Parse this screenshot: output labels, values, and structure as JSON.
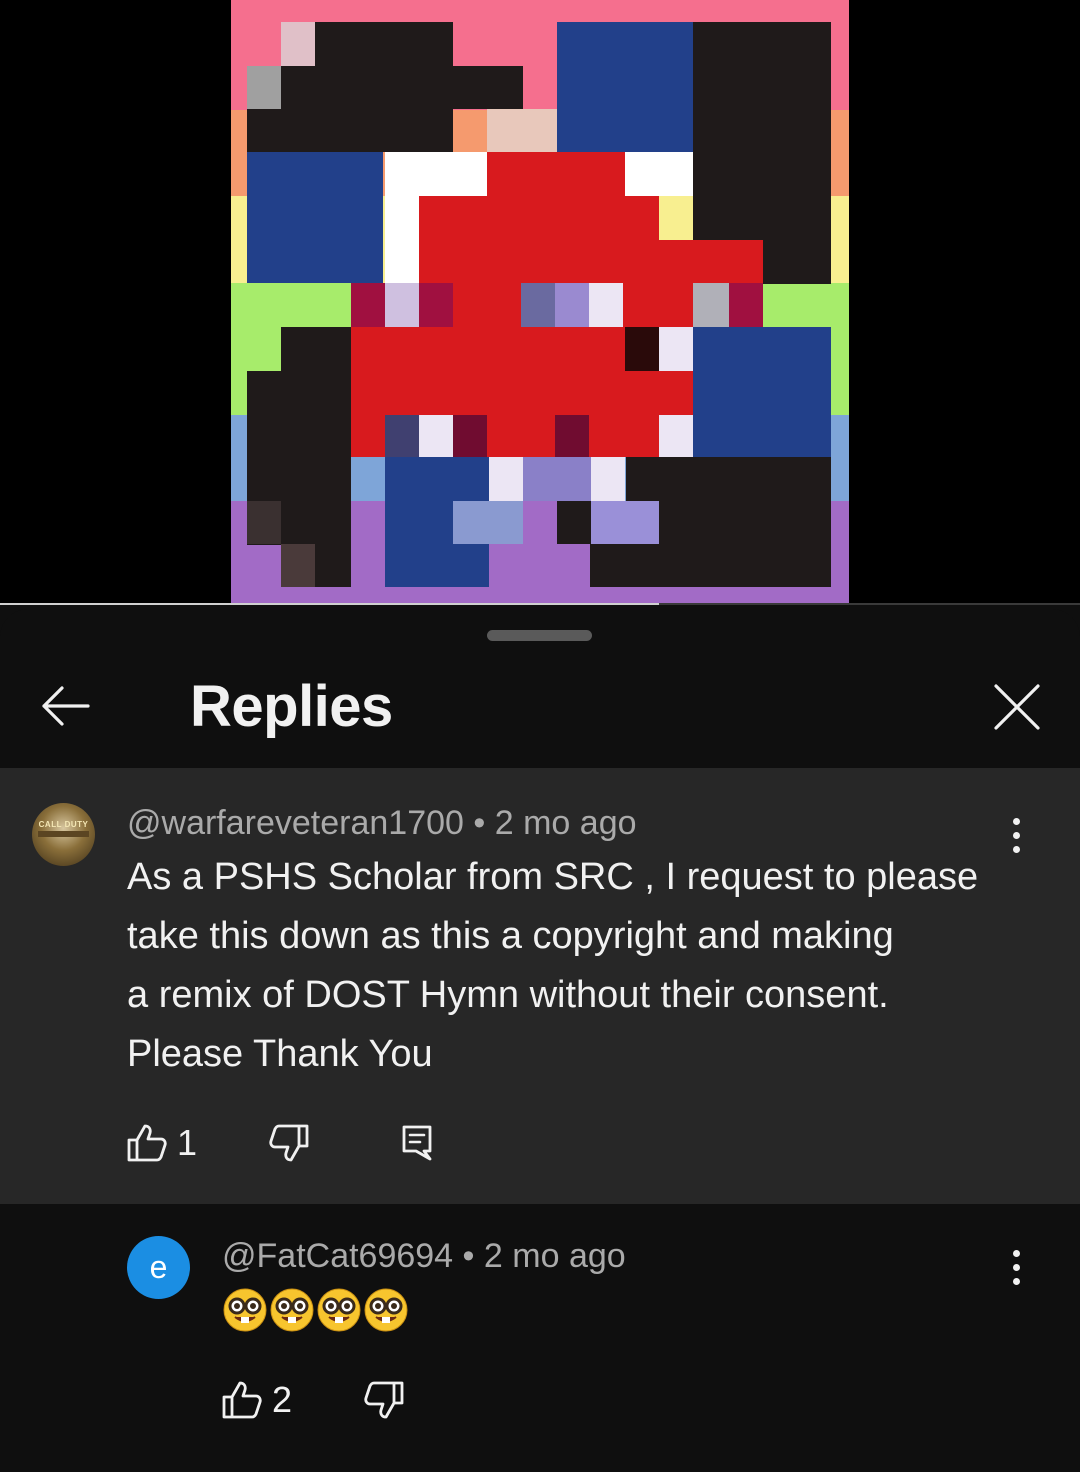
{
  "header": {
    "title": "Replies"
  },
  "comments": [
    {
      "author": "@warfareveteran1700",
      "separator": "•",
      "time": "2 mo ago",
      "text": "As a PSHS Scholar from SRC , I request to please\ntake this down as this a copyright and making\na remix of DOST Hymn without their consent.\nPlease Thank You",
      "likes": "1",
      "avatar_text": "CALL DUTY"
    },
    {
      "author": "@FatCat69694",
      "separator": "•",
      "time": "2 mo ago",
      "avatar_letter": "e",
      "emoji_name": "nerd-face-emoji",
      "emoji_count": 4,
      "likes": "2"
    }
  ],
  "video": {
    "progress": 0.61
  },
  "colors": {
    "background": "#0f0f0f",
    "highlight": "#272727",
    "avatar_blue": "#1b8ee3",
    "text_secondary": "#aaaaaa"
  }
}
